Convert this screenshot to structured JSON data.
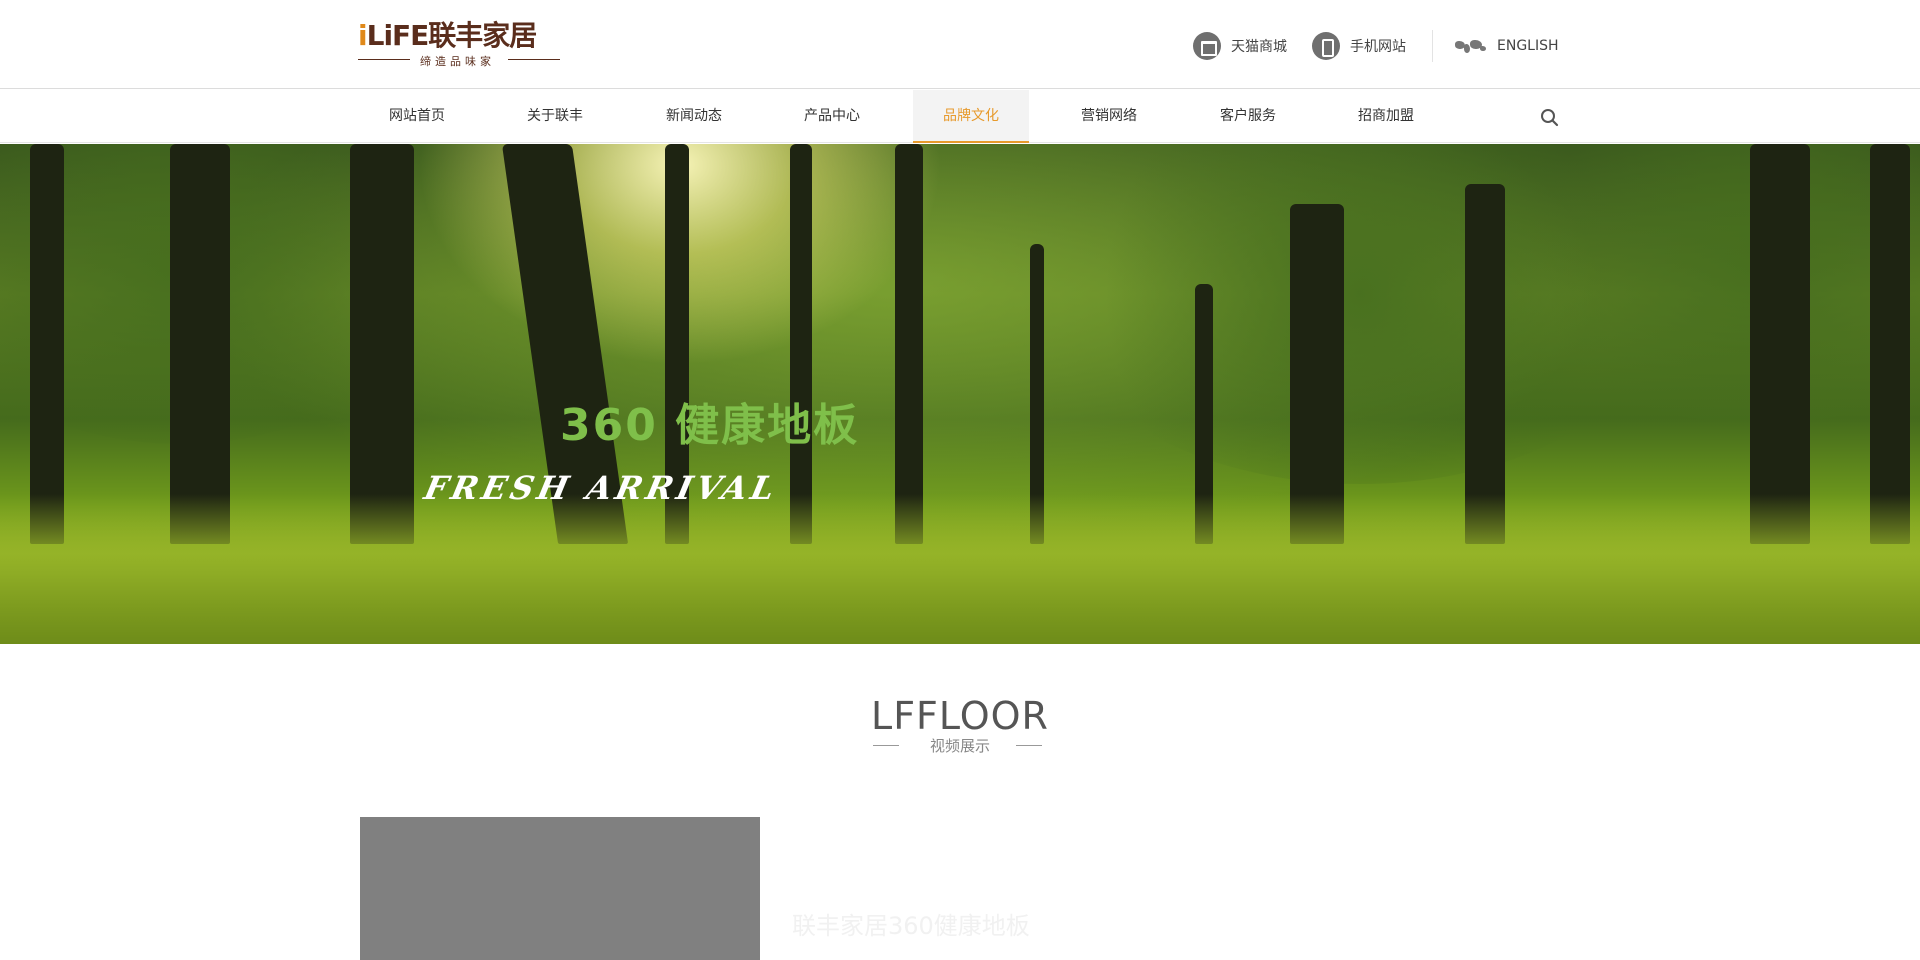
{
  "header": {
    "logo_brand_i": "i",
    "logo_brand_rest": "LiFE联丰家居",
    "logo_tagline": "缔造品味家",
    "links": {
      "tmall": "天猫商城",
      "mobile": "手机网站",
      "english": "ENGLISH"
    },
    "icons": {
      "tmall": "shopping-bag-icon",
      "mobile": "mobile-phone-icon",
      "english": "world-map-icon"
    }
  },
  "nav": {
    "items": [
      {
        "label": "网站首页",
        "active": false
      },
      {
        "label": "关于联丰",
        "active": false
      },
      {
        "label": "新闻动态",
        "active": false
      },
      {
        "label": "产品中心",
        "active": false
      },
      {
        "label": "品牌文化",
        "active": true
      },
      {
        "label": "营销网络",
        "active": false
      },
      {
        "label": "客户服务",
        "active": false
      },
      {
        "label": "招商加盟",
        "active": false
      }
    ],
    "search_icon": "search-icon"
  },
  "banner": {
    "title": "360 健康地板",
    "subtitle": "FRESH ARRIVAL"
  },
  "video_section": {
    "title": "LFFLOOR",
    "subtitle": "视频展示",
    "description": "联丰家居360健康地板"
  },
  "colors": {
    "accent": "#e79a2c",
    "brand": "#5a2d1c",
    "banner_title": "#7fbf4a"
  }
}
